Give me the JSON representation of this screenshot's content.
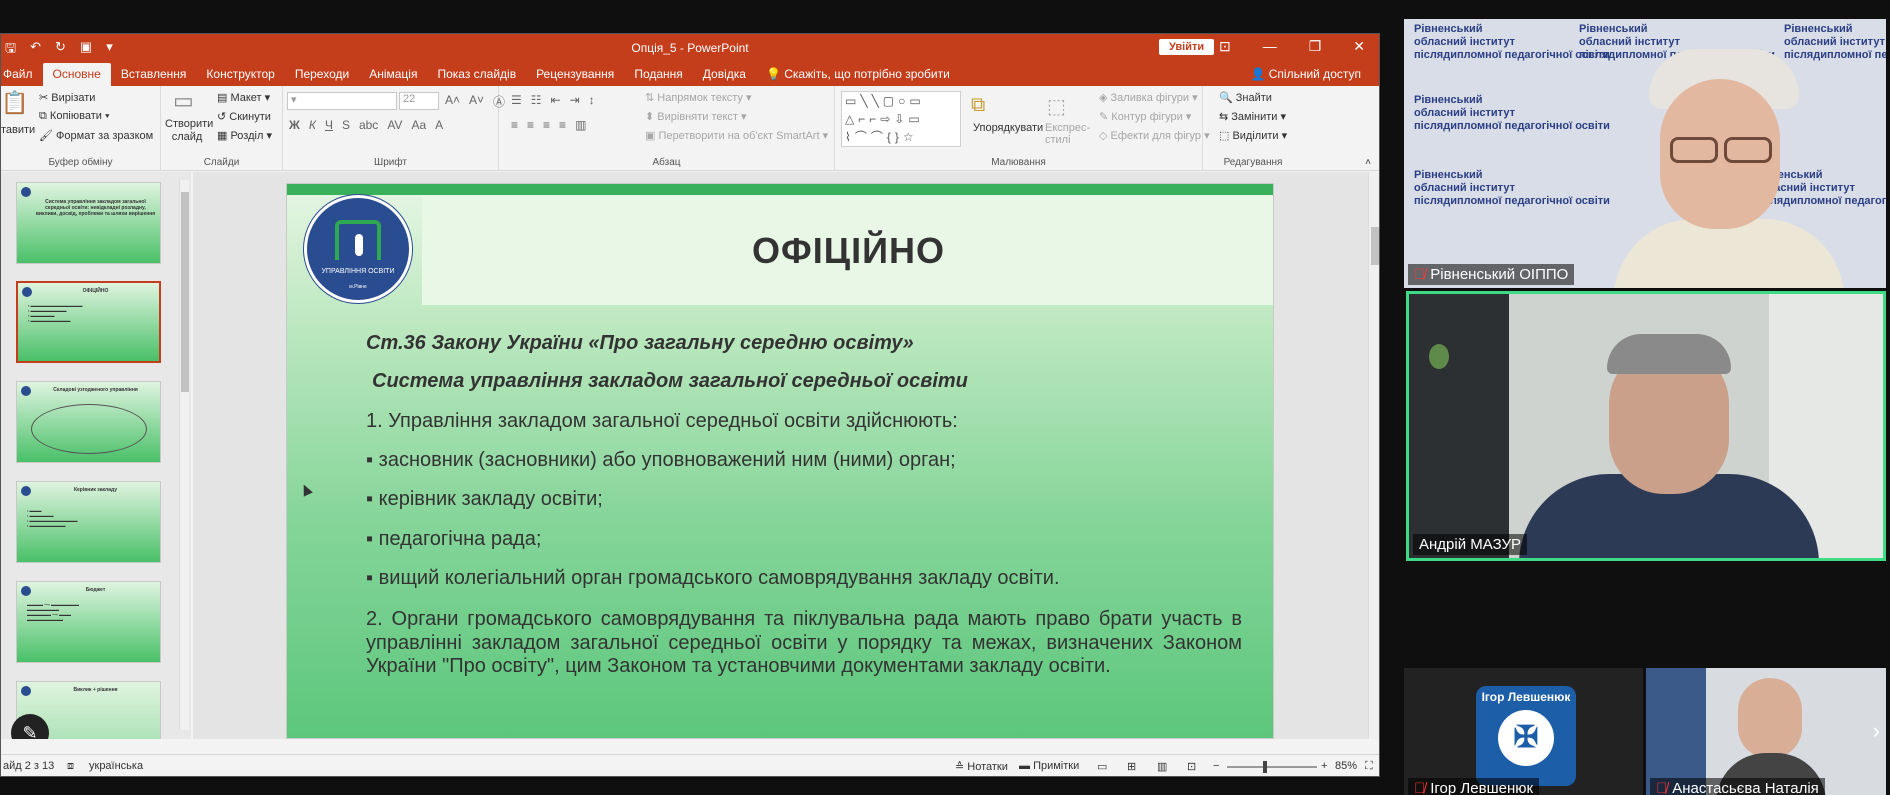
{
  "powerpoint": {
    "window_title": "Опція_5  -  PowerPoint",
    "signin_label": "Увійти",
    "tabs": [
      "Файл",
      "Основне",
      "Вставлення",
      "Конструктор",
      "Переходи",
      "Анімація",
      "Показ слайдів",
      "Рецензування",
      "Подання",
      "Довідка"
    ],
    "tell_me": "Скажіть, що потрібно зробити",
    "share": "Спільний доступ",
    "ribbon": {
      "clipboard_label": "Буфер обміну",
      "paste": "тавити",
      "cut": "Вирізати",
      "copy": "Копіювати",
      "format_painter": "Формат за зразком",
      "slides_label": "Слайди",
      "new_slide": "Створити слайд",
      "layout": "Макет",
      "reset": "Скинути",
      "section": "Розділ",
      "font_label": "Шрифт",
      "font_size": "22",
      "paragraph_label": "Абзац",
      "text_direction": "Напрямок тексту",
      "align_text": "Вирівняти текст",
      "smartart": "Перетворити на об'єкт SmartArt",
      "drawing_label": "Малювання",
      "arrange": "Упорядкувати",
      "quick_styles": "Експрес-стилі",
      "shape_fill": "Заливка фігури",
      "shape_outline": "Контур фігури",
      "shape_effects": "Ефекти для фігур",
      "editing_label": "Редагування",
      "find": "Знайти",
      "replace": "Замінити",
      "select": "Виділити"
    },
    "thumbnails": [
      {
        "title": "Система управління закладом загальної середньої освіти: невідкладні розладну, виклики, досвід, проблеми та шляхи вирішення"
      },
      {
        "title": "ОФІЦІЙНО",
        "selected": true
      },
      {
        "title": "Складові узгодженого управління"
      },
      {
        "title": "Керівник закладу"
      },
      {
        "title": "Бюджет"
      },
      {
        "title": "Виклик + рішення"
      }
    ],
    "slide": {
      "title": "ОФІЦІЙНО",
      "emblem_text": "УПРАВЛІННЯ ОСВІТИ",
      "emblem_city": "м.Рівне",
      "heading1": "Ст.36 Закону України «Про загальну середню освіту»",
      "heading2": "Система управління закладом загальної середньої освіти",
      "line1": "1. Управління закладом загальної середньої освіти здійснюють:",
      "bullet1": "▪ засновник (засновники) або уповноважений ним (ними) орган;",
      "bullet2": "▪ керівник закладу освіти;",
      "bullet3": "▪ педагогічна рада;",
      "bullet4": "▪ вищий колегіальний орган громадського самоврядування закладу освіти.",
      "para2": "2. Органи громадського самоврядування та піклувальна рада мають право брати участь в управлінні закладом загальної середньої освіти у порядку та межах, визначених Законом України \"Про освіту\", цим Законом та установчими документами закладу освіти."
    },
    "status": {
      "slide_counter": "айд 2 з 13",
      "language": "українська",
      "notes": "Нотатки",
      "comments": "Примітки",
      "zoom": "85%"
    }
  },
  "video": {
    "wall_text": [
      "Рівненський",
      "обласний інститут",
      "післядипломної педагогічної освіти"
    ],
    "participants": [
      {
        "name": "Рівненський ОІППО",
        "muted": true
      },
      {
        "name": "Андрій МАЗУР",
        "muted": false
      },
      {
        "name": "Ігор Левшенюк",
        "muted": true,
        "avatar_text": "Ігор Левшенюк"
      },
      {
        "name": "Анастасьєва Наталія",
        "muted": true
      }
    ]
  },
  "colors": {
    "ppt_accent": "#c43e1c",
    "slide_green": "#38b15a",
    "active_speaker": "#3ddc84"
  }
}
